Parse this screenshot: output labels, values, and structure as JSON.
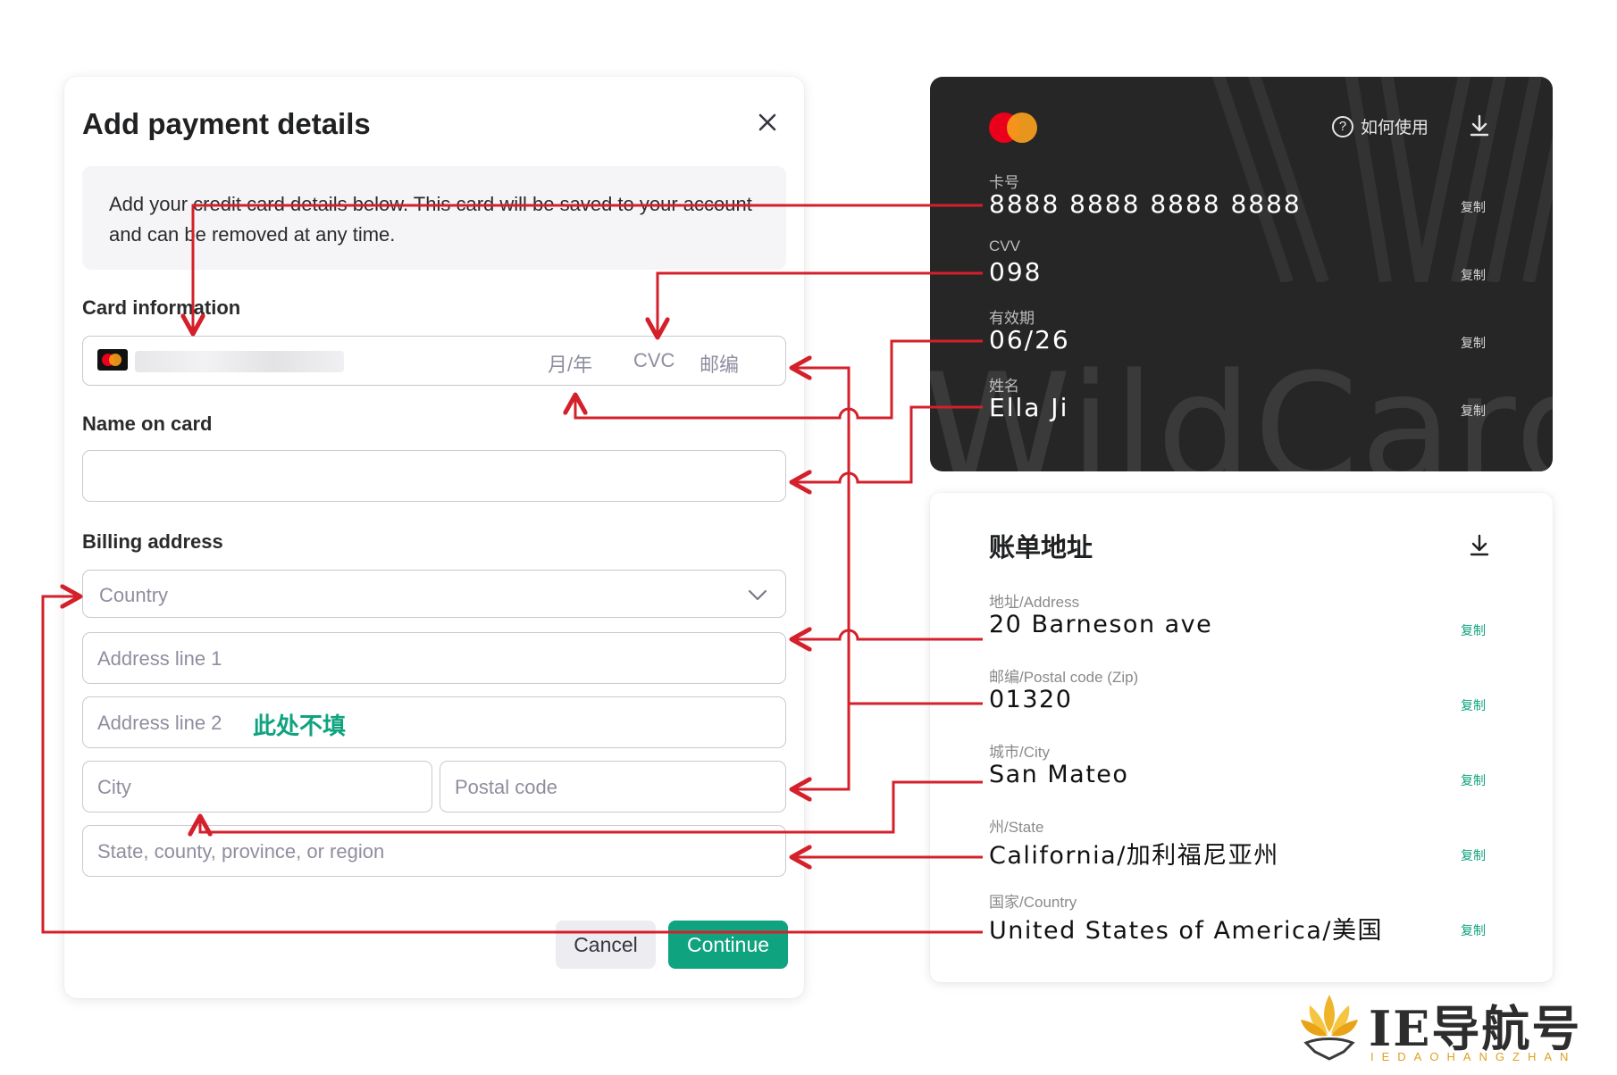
{
  "modal": {
    "title": "Add payment details",
    "info": "Add your credit card details below. This card will be saved to your account and can be removed at any time.",
    "card_section": "Card information",
    "card_field": {
      "expiry_placeholder": "月/年",
      "cvc_placeholder": "CVC",
      "zip_placeholder": "邮编"
    },
    "name_section": "Name on card",
    "billing_section": "Billing address",
    "country_placeholder": "Country",
    "address1_placeholder": "Address line 1",
    "address2_placeholder": "Address line 2",
    "address2_note": "此处不填",
    "city_placeholder": "City",
    "postal_placeholder": "Postal code",
    "state_placeholder": "State, county, province, or region",
    "cancel_label": "Cancel",
    "continue_label": "Continue"
  },
  "card": {
    "howto_label": "如何使用",
    "watermark": "WildCard",
    "fields": [
      {
        "label": "卡号",
        "value": "8888 8888 8888 8888",
        "copy": "复制"
      },
      {
        "label": "CVV",
        "value": "098",
        "copy": "复制"
      },
      {
        "label": "有效期",
        "value": "06/26",
        "copy": "复制"
      },
      {
        "label": "姓名",
        "value": "Ella Ji",
        "copy": "复制"
      }
    ]
  },
  "address": {
    "title": "账单地址",
    "fields": [
      {
        "label": "地址/Address",
        "value": "20 Barneson ave",
        "copy": "复制"
      },
      {
        "label": "邮编/Postal code (Zip)",
        "value": "01320",
        "copy": "复制"
      },
      {
        "label": "城市/City",
        "value": "San Mateo",
        "copy": "复制"
      },
      {
        "label": "州/State",
        "value": "California/加利福尼亚州",
        "copy": "复制"
      },
      {
        "label": "国家/Country",
        "value": "United States of America/美国",
        "copy": "复制"
      }
    ]
  },
  "brand": {
    "name": "IE导航号",
    "sub": "IEDAOHANGZHAN"
  },
  "colors": {
    "accent": "#10a37f",
    "arrow": "#d4202a",
    "card_bg": "#262626"
  }
}
